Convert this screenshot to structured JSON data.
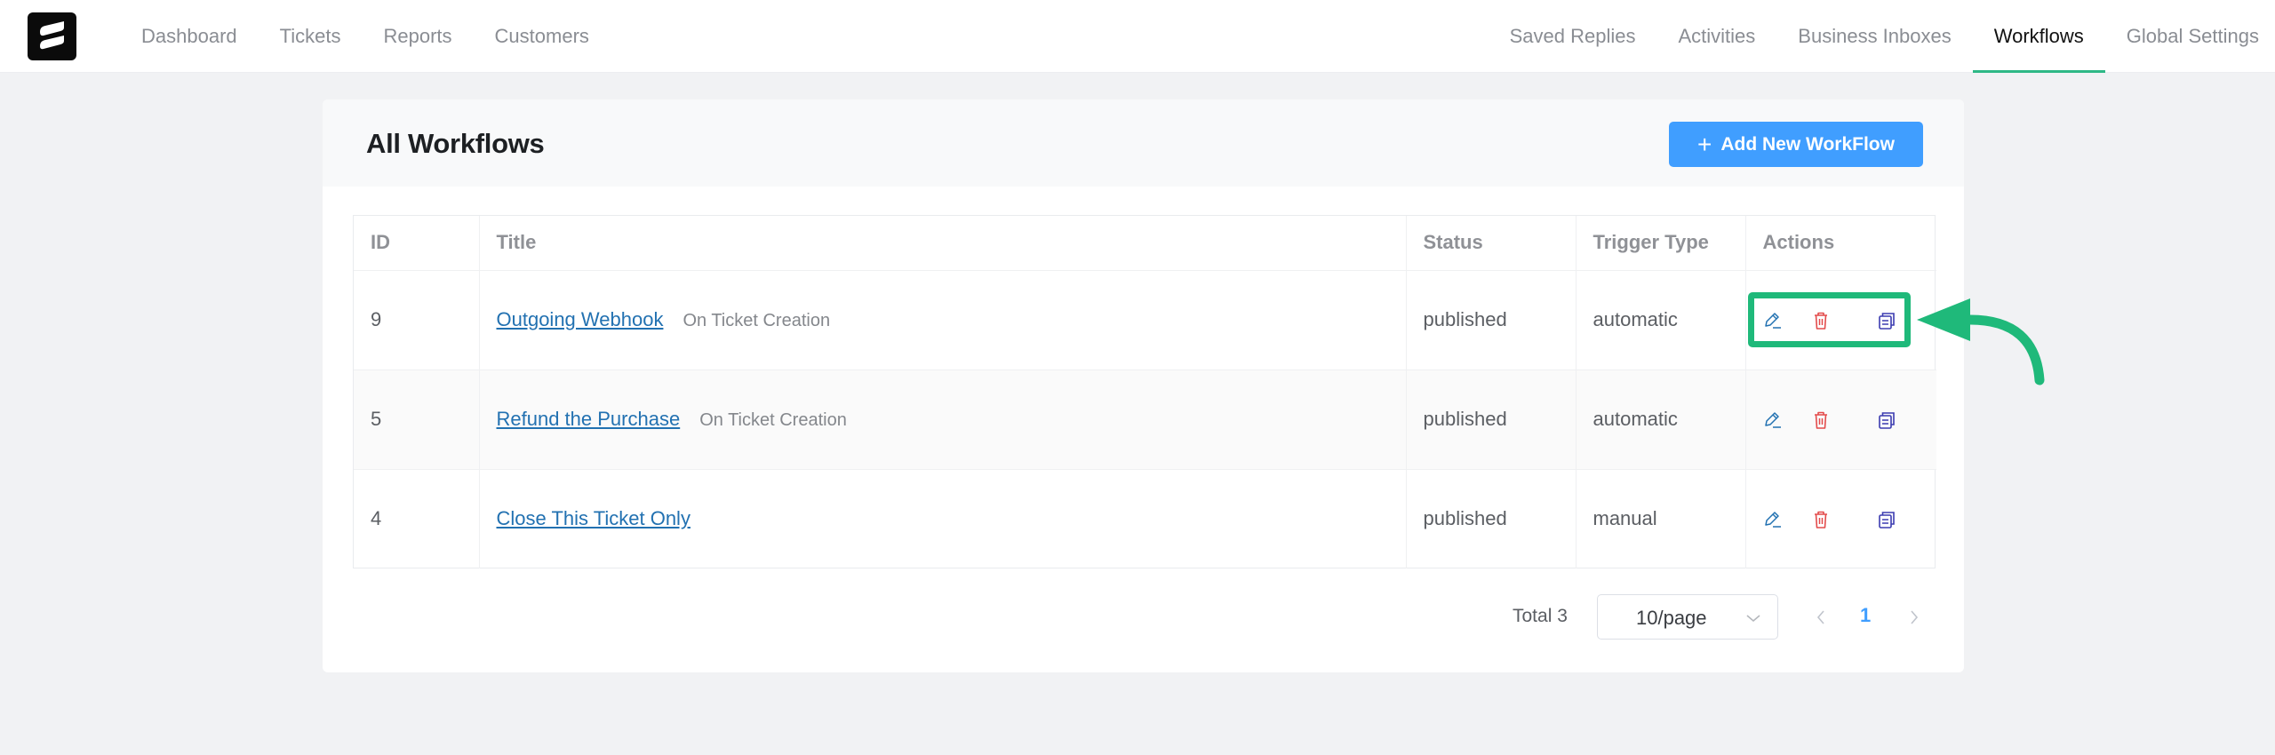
{
  "nav": {
    "logo": "fluent-support-logo",
    "left": [
      {
        "label": "Dashboard",
        "active": false
      },
      {
        "label": "Tickets",
        "active": false
      },
      {
        "label": "Reports",
        "active": false
      },
      {
        "label": "Customers",
        "active": false
      }
    ],
    "right": [
      {
        "label": "Saved Replies",
        "active": false
      },
      {
        "label": "Activities",
        "active": false
      },
      {
        "label": "Business Inboxes",
        "active": false
      },
      {
        "label": "Workflows",
        "active": true
      },
      {
        "label": "Global Settings",
        "active": false
      }
    ]
  },
  "page": {
    "title": "All Workflows",
    "add_button": {
      "icon": "plus-icon",
      "label": "Add New WorkFlow"
    }
  },
  "table": {
    "columns": [
      "ID",
      "Title",
      "Status",
      "Trigger Type",
      "Actions"
    ],
    "rows": [
      {
        "id": "9",
        "title": "Outgoing Webhook",
        "trigger": "On Ticket Creation",
        "status": "published",
        "trigger_type": "automatic"
      },
      {
        "id": "5",
        "title": "Refund the Purchase",
        "trigger": "On Ticket Creation",
        "status": "published",
        "trigger_type": "automatic"
      },
      {
        "id": "4",
        "title": "Close This Ticket Only",
        "trigger": "",
        "status": "published",
        "trigger_type": "manual"
      }
    ],
    "actions": [
      {
        "icon": "edit-pencil-icon",
        "color": "#2271b1"
      },
      {
        "icon": "trash-icon",
        "color": "#e34b4b"
      },
      {
        "icon": "duplicate-icon",
        "color": "#3b3bb0"
      }
    ]
  },
  "pagination": {
    "total_label": "Total 3",
    "page_size": "10/page",
    "current_page": "1"
  },
  "annotation": {
    "highlight_color": "#1fb97a",
    "target": "row-1-actions"
  },
  "colors": {
    "accent": "#409eff",
    "active_tab": "#2eb886",
    "link": "#2271b1"
  }
}
